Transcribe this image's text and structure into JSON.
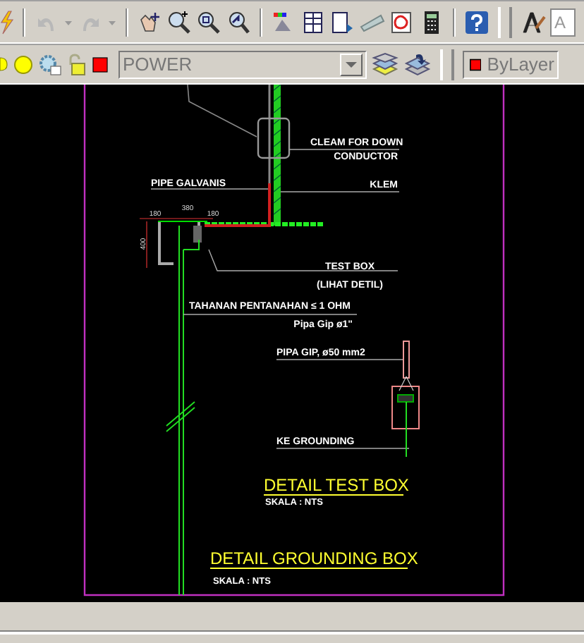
{
  "toolbar": {
    "style_field": "A"
  },
  "layers_toolbar": {
    "layer": "POWER",
    "color_control": "ByLayer"
  },
  "drawing": {
    "labels": [
      {
        "kind": "note",
        "text": "CLEAM FOR DOWN"
      },
      {
        "kind": "note",
        "text": "CONDUCTOR"
      },
      {
        "kind": "note",
        "text": "KLEM"
      },
      {
        "kind": "note",
        "text": "PIPE GALVANIS"
      },
      {
        "kind": "dimension",
        "text": "180"
      },
      {
        "kind": "dimension",
        "text": "380"
      },
      {
        "kind": "dimension",
        "text": "180"
      },
      {
        "kind": "dimension",
        "text": "400"
      },
      {
        "kind": "note",
        "text": "TEST BOX"
      },
      {
        "kind": "note",
        "text": "(LIHAT DETIL)"
      },
      {
        "kind": "note",
        "text": "TAHANAN PENTANAHAN ≤ 1 OHM"
      },
      {
        "kind": "note",
        "text": "Pipa Gip ø1\""
      },
      {
        "kind": "note",
        "text": "PIPA GIP, ø50 mm2"
      },
      {
        "kind": "note",
        "text": "KE GROUNDING"
      },
      {
        "kind": "title",
        "text": "DETAIL TEST BOX"
      },
      {
        "kind": "scale",
        "text": "SKALA : NTS"
      },
      {
        "kind": "title",
        "text": "DETAIL GROUNDING BOX"
      },
      {
        "kind": "scale",
        "text": "SKALA : NTS"
      }
    ]
  }
}
